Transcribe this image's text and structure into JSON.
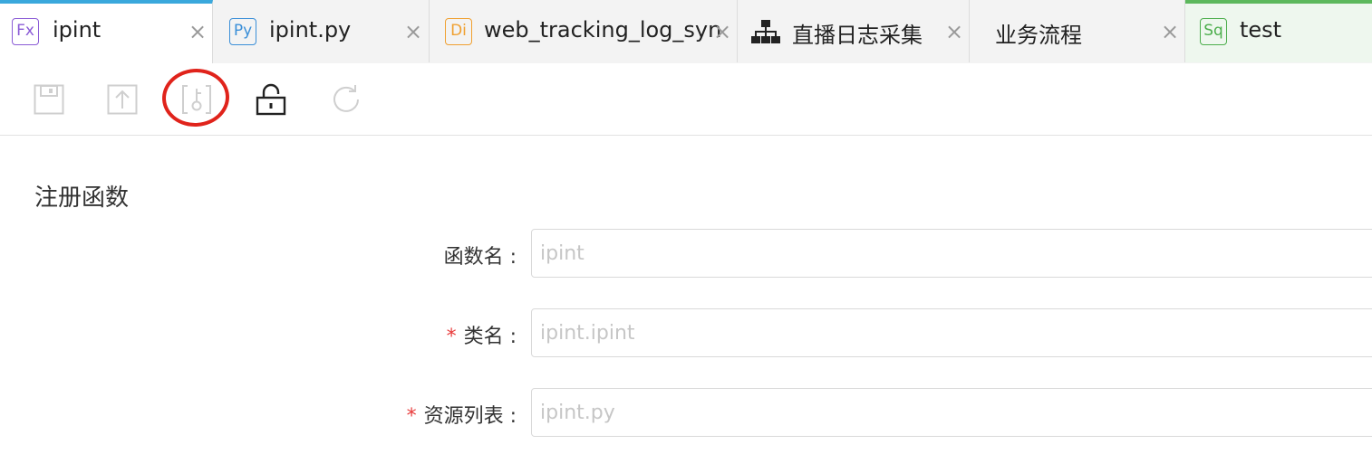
{
  "tabs": [
    {
      "badge": "Fx",
      "badge_color": "#8b5cd6",
      "label": "ipint",
      "close": "×"
    },
    {
      "badge": "Py",
      "badge_color": "#3b8fd8",
      "label": "ipint.py",
      "close": "×"
    },
    {
      "badge": "Di",
      "badge_color": "#f0a030",
      "label": "web_tracking_log_syn",
      "close": "×"
    },
    {
      "badge": "",
      "label": "直播日志采集",
      "close": "×"
    },
    {
      "badge": "",
      "label": "业务流程",
      "close": "×"
    },
    {
      "badge": "Sq",
      "badge_color": "#4cae4c",
      "label": "test",
      "close": ""
    }
  ],
  "toolbar": {
    "icons": [
      "save-icon",
      "upload-icon",
      "register-key-icon",
      "unlock-icon",
      "refresh-icon"
    ],
    "highlight_color": "#e0231b"
  },
  "form": {
    "title": "注册函数",
    "fields": [
      {
        "label": "函数名 :",
        "required": false,
        "placeholder": "ipint"
      },
      {
        "label": "类名 :",
        "required": true,
        "placeholder": "ipint.ipint"
      },
      {
        "label": "资源列表 :",
        "required": true,
        "placeholder": "ipint.py"
      }
    ],
    "required_mark": "*"
  },
  "colors": {
    "active_tab_accent": "#3aa8dc",
    "last_tab_accent": "#5cb85c"
  }
}
